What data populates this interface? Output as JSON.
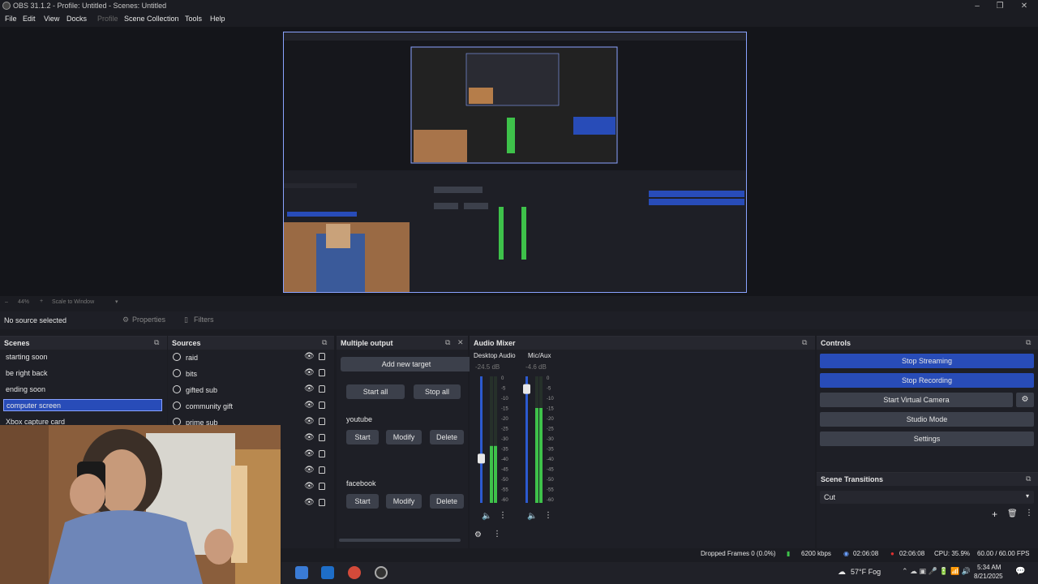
{
  "window": {
    "title": "OBS 31.1.2 - Profile: Untitled - Scenes: Untitled"
  },
  "menu": [
    {
      "label": "File",
      "enabled": true
    },
    {
      "label": "Edit",
      "enabled": true
    },
    {
      "label": "View",
      "enabled": true
    },
    {
      "label": "Docks",
      "enabled": true
    },
    {
      "label": "Profile",
      "enabled": false
    },
    {
      "label": "Scene Collection",
      "enabled": true
    },
    {
      "label": "Tools",
      "enabled": true
    },
    {
      "label": "Help",
      "enabled": true
    }
  ],
  "zoom": {
    "level": "44%",
    "scale_label": "Scale to Window"
  },
  "source_bar": {
    "no_source": "No source selected",
    "properties": "Properties",
    "filters": "Filters"
  },
  "scenes": {
    "title": "Scenes",
    "items": [
      "starting soon",
      "be right back",
      "ending soon",
      "computer screen",
      "Xbox capture card"
    ],
    "selected": "computer screen"
  },
  "sources": {
    "title": "Sources",
    "items": [
      "raid",
      "bits",
      "gifted sub",
      "community gift",
      "prime sub"
    ]
  },
  "multiple_output": {
    "title": "Multiple output",
    "add_target": "Add new target",
    "start_all": "Start all",
    "stop_all": "Stop all",
    "targets": [
      {
        "name": "youtube",
        "start": "Start",
        "modify": "Modify",
        "delete": "Delete"
      },
      {
        "name": "facebook",
        "start": "Start",
        "modify": "Modify",
        "delete": "Delete"
      }
    ]
  },
  "audio_mixer": {
    "title": "Audio Mixer",
    "channels": [
      {
        "name": "Desktop Audio",
        "db": "-24.5 dB",
        "volume": 0.35,
        "meter": 0.45
      },
      {
        "name": "Mic/Aux",
        "db": "-4.6 dB",
        "volume": 0.9,
        "meter": 0.75
      }
    ],
    "scale": [
      "0",
      "-5",
      "-10",
      "-15",
      "-20",
      "-25",
      "-30",
      "-35",
      "-40",
      "-45",
      "-50",
      "-55",
      "-60"
    ]
  },
  "controls": {
    "title": "Controls",
    "stop_streaming": "Stop Streaming",
    "stop_recording": "Stop Recording",
    "start_virtual_camera": "Start Virtual Camera",
    "studio_mode": "Studio Mode",
    "settings": "Settings"
  },
  "scene_transitions": {
    "title": "Scene Transitions",
    "selected": "Cut"
  },
  "status": {
    "dropped_frames": "Dropped Frames 0 (0.0%)",
    "bitrate": "6200 kbps",
    "stream_time": "02:06:08",
    "rec_time": "02:06:08",
    "cpu": "CPU: 35.9%",
    "fps": "60.00 / 60.00 FPS"
  },
  "taskbar": {
    "weather": "57°F  Fog",
    "time": "5:34 AM",
    "date": "8/21/2025"
  },
  "colors": {
    "accent": "#284cb8",
    "accent_border": "#8aa3ff",
    "panel": "#1e1f26",
    "button": "#3c404b",
    "meter_green": "#3ec24a"
  }
}
